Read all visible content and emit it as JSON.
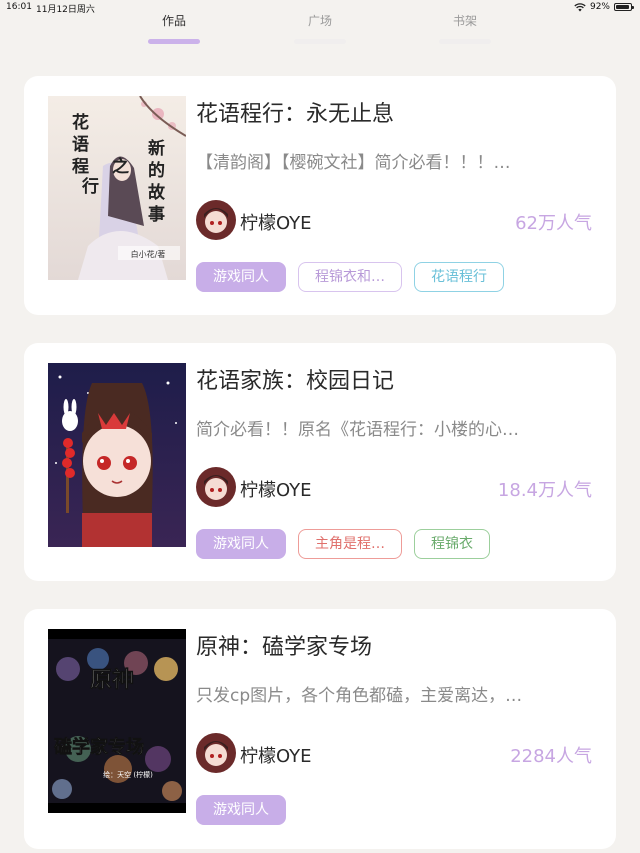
{
  "status_bar": {
    "time": "16:01",
    "date": "11月12日周六",
    "battery": "92%",
    "battery_level": 0.92
  },
  "tabs": [
    {
      "label": "作品",
      "active": true
    },
    {
      "label": "广场",
      "active": false
    },
    {
      "label": "书架",
      "active": false
    }
  ],
  "colors": {
    "accent": "#c8aee8",
    "popularity": "#c7a6e2",
    "background": "#f4f2ef"
  },
  "works": [
    {
      "title": "花语程行：永无止息",
      "description": "【清韵阁】【樱碗文社】简介必看！！！…",
      "author": "柠檬OYE",
      "popularity": "62万人气",
      "cover_text": [
        "花",
        "语",
        "程",
        "行",
        "之",
        "新",
        "的",
        "故",
        "事"
      ],
      "tags": [
        {
          "label": "游戏同人",
          "style": "filled"
        },
        {
          "label": "程锦衣和…",
          "style": "purple"
        },
        {
          "label": "花语程行",
          "style": "cyan"
        }
      ]
    },
    {
      "title": "花语家族：校园日记",
      "description": "简介必看！！原名《花语程行：小楼的心…",
      "author": "柠檬OYE",
      "popularity": "18.4万人气",
      "tags": [
        {
          "label": "游戏同人",
          "style": "filled"
        },
        {
          "label": "主角是程…",
          "style": "red"
        },
        {
          "label": "程锦衣",
          "style": "green"
        }
      ]
    },
    {
      "title": "原神：磕学家专场",
      "description": "只发cp图片，各个角色都磕，主爱离达，…",
      "author": "柠檬OYE",
      "popularity": "2284人气",
      "cover_text": [
        "原神",
        "磕学家专场"
      ],
      "tags": [
        {
          "label": "游戏同人",
          "style": "filled"
        }
      ]
    }
  ]
}
